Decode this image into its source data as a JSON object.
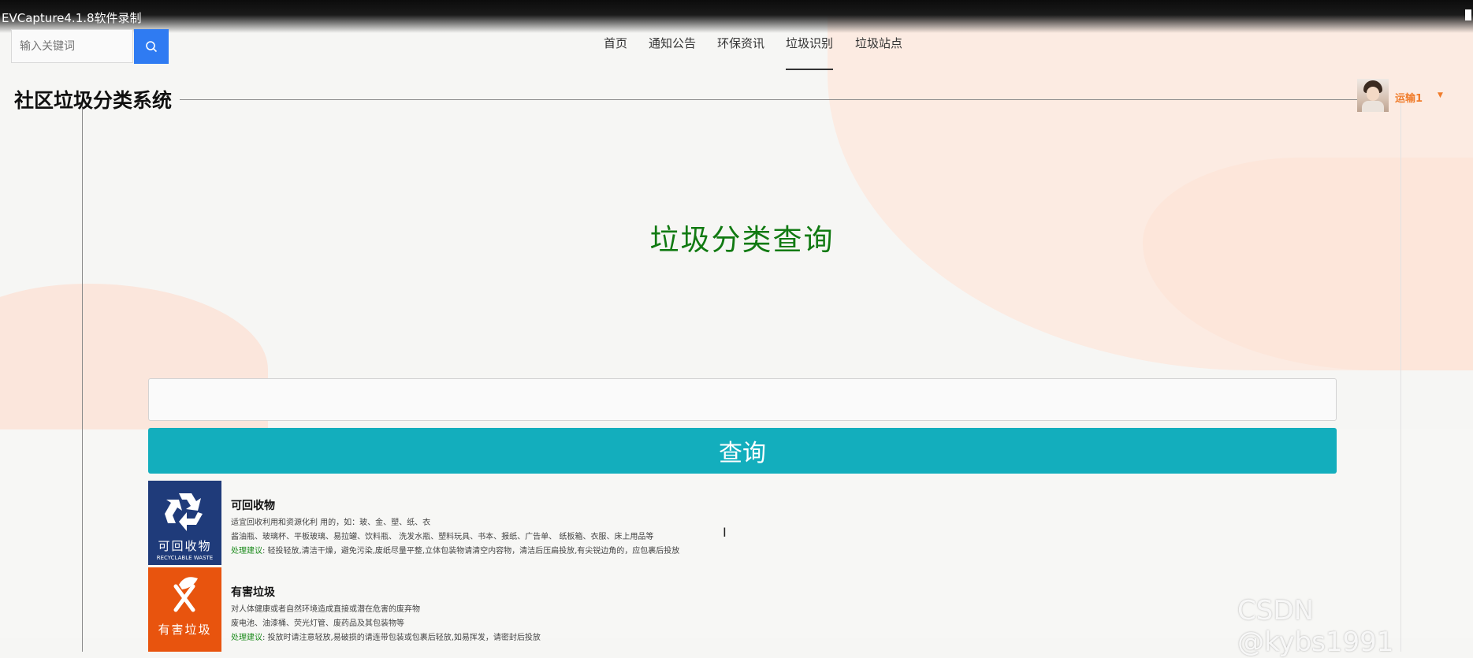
{
  "window": {
    "title": "EVCapture4.1.8软件录制"
  },
  "search": {
    "placeholder": "输入关键词"
  },
  "nav": {
    "items": [
      {
        "label": "首页"
      },
      {
        "label": "通知公告"
      },
      {
        "label": "环保资讯"
      },
      {
        "label": "垃圾识别",
        "active": true
      },
      {
        "label": "垃圾站点"
      }
    ]
  },
  "site": {
    "title": "社区垃圾分类系统"
  },
  "user": {
    "name": "运输1"
  },
  "main": {
    "heading": "垃圾分类查询",
    "query_input_value": "",
    "query_button": "查询"
  },
  "categories": [
    {
      "badge_cn": "可回收物",
      "badge_en": "RECYCLABLE WASTE",
      "badge_color": "#1f3b7a",
      "icon": "recycle-icon",
      "name": "可回收物",
      "desc": "适宜回收利用和资源化利 用的，如：玻、金、塑、纸、衣",
      "examples": "酱油瓶、玻璃杯、平板玻璃、易拉罐、饮料瓶、 洗发水瓶、塑料玩具、书本、报纸、广告单、 纸板箱、衣服、床上用品等",
      "advice_label": "处理建议",
      "advice": ": 轻投轻放,清洁干燥，避免污染,废纸尽量平整,立体包装物请清空内容物，清洁后压扁投放,有尖锐边角的，应包裹后投放"
    },
    {
      "badge_cn": "有害垃圾",
      "badge_color": "#e8540e",
      "icon": "hazardous-waste-icon",
      "name": "有害垃圾",
      "desc": "对人体健康或者自然环境造成直接或潜在危害的废弃物",
      "examples": "废电池、油漆桶、荧光灯管、废药品及其包装物等",
      "advice_label": "处理建议",
      "advice": ": 投放时请注意轻放,易破损的请连带包装或包裹后轻放,如易挥发，请密封后投放"
    }
  ],
  "watermark": "CSDN @kybs1991"
}
